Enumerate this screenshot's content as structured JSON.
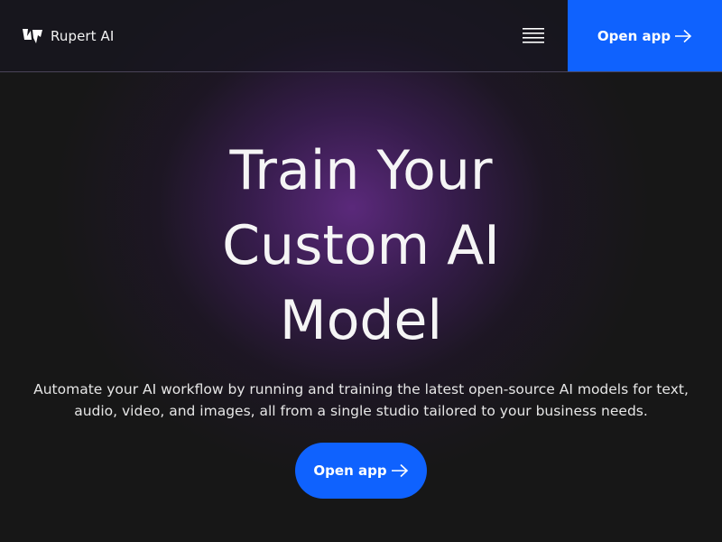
{
  "brand": {
    "name": "Rupert AI",
    "logo_icon": "rupert-logo-icon"
  },
  "header": {
    "menu_icon": "hamburger-menu-icon",
    "cta_label": "Open app",
    "cta_icon": "arrow-right-icon"
  },
  "hero": {
    "title": "Train Your Custom AI Model",
    "subtitle": "Automate your AI workflow by running and training the latest open-source AI models for text, audio, video, and images, all from a single studio tailored to your business needs.",
    "cta_label": "Open app",
    "cta_icon": "arrow-right-icon"
  },
  "colors": {
    "accent": "#0f62fe",
    "background": "#171717",
    "glow": "#5e2a80"
  }
}
